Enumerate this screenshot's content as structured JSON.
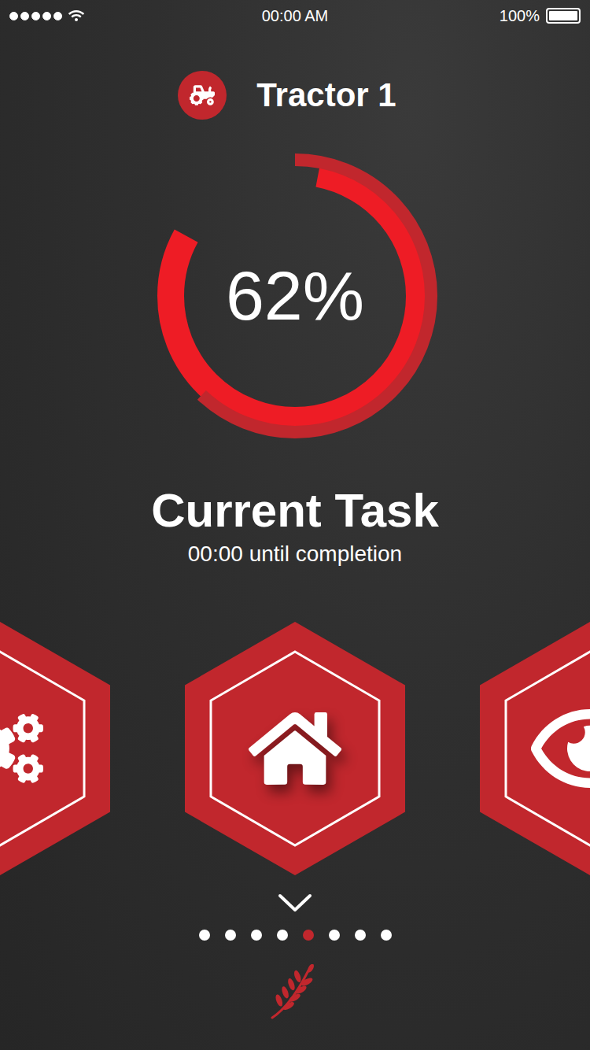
{
  "status_bar": {
    "signal": {
      "level": 1
    },
    "wifi": true,
    "time": "00:00 AM",
    "battery": {
      "reading": "100%",
      "level": 1
    }
  },
  "header": {
    "title": "Tractor 1"
  },
  "progress": {
    "reading": "62%",
    "level": 0.62
  },
  "task": {
    "title": "Current Task",
    "subtitle": "00:00 until completion"
  },
  "carousel": [
    {
      "kind": "settings",
      "selected": false
    },
    {
      "kind": "home",
      "selected": true
    },
    {
      "kind": "view",
      "selected": false
    }
  ],
  "pages": [
    {
      "selected": false
    },
    {
      "selected": false
    },
    {
      "selected": false
    },
    {
      "selected": false
    },
    {
      "selected": true
    },
    {
      "selected": false
    },
    {
      "selected": false
    },
    {
      "selected": false
    }
  ]
}
